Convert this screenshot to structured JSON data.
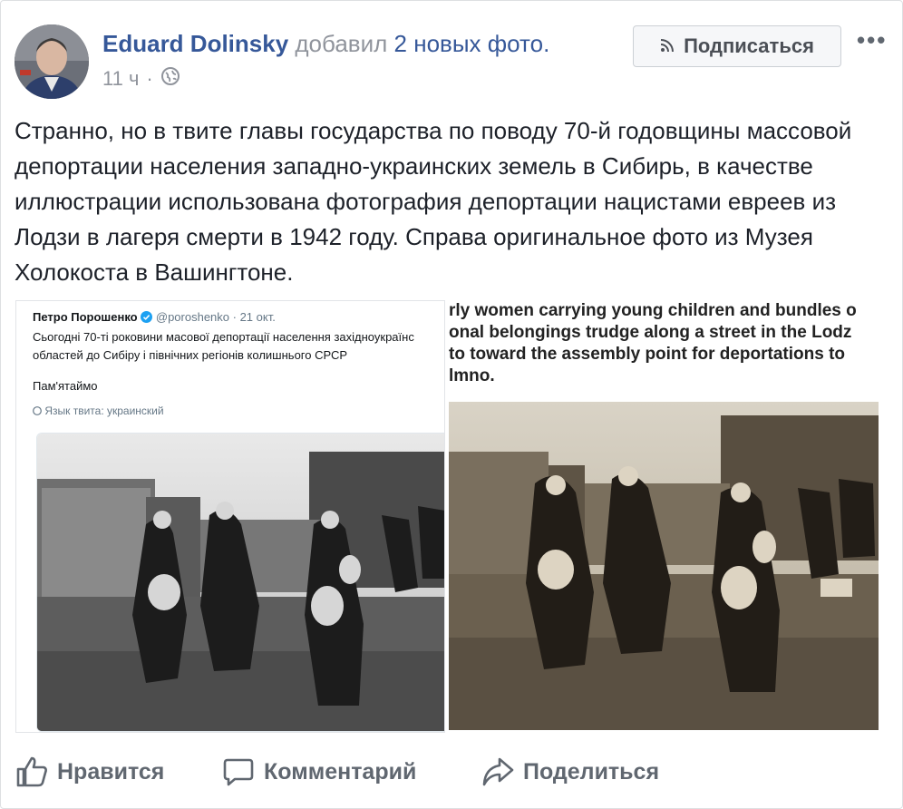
{
  "post": {
    "author": "Eduard Dolinsky",
    "action": "добавил",
    "photos_link": "2 новых фото.",
    "time": "11 ч",
    "time_separator": "·",
    "subscribe_label": "Подписаться",
    "more_label": "•••",
    "text": "Странно, но в твите главы государства по поводу 70-й годовщины массовой депортации населения западно-украинских земель в Сибирь, в качестве иллюстрации использована фотография депортации нацистами евреев из Лодзи в лагеря смерти в 1942 году. Справа оригинальное фото из Музея Холокоста в Вашингтоне."
  },
  "tweet": {
    "name": "Петро Порошенко",
    "handle": "@poroshenko",
    "date": "· 21 окт.",
    "line1": "Сьогодні 70-ті роковини масової депортації населення західноукраїнс",
    "line2": "областей до Сибіру і північних регіонів колишнього СРСР",
    "remember": "Пам'ятаймо",
    "lang": "Язык твита: украинский"
  },
  "museum": {
    "caption": "rly women carrying young children and bundles o\nonal belongings trudge along a street in the Lodz\nto toward the assembly point for deportations to\nlmno."
  },
  "actions": {
    "like": "Нравится",
    "comment": "Комментарий",
    "share": "Поделиться"
  },
  "colors": {
    "link": "#365899",
    "muted": "#90949c",
    "action_text": "#606770",
    "twitter_blue": "#1da1f2"
  }
}
